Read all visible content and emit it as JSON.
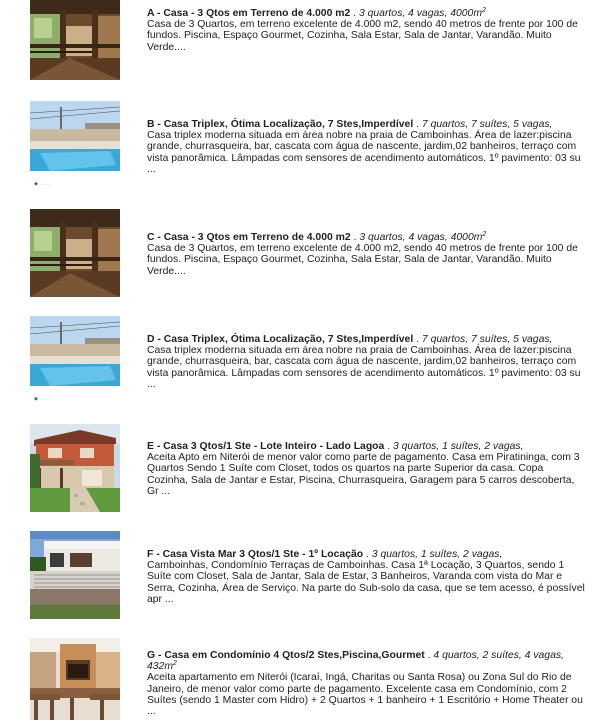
{
  "listings": [
    {
      "title": "A - Casa - 3 Qtos em Terreno de 4.000 m2",
      "meta": "3 quartos, 4 vagas, 4000m",
      "meta_sup": "2",
      "description": "Casa de 3 Quartos, em terreno excelente de 4.000 m2, sendo 40 metros de frente por 100 de fundos. Piscina, Espaço Gourmet, Cozinha, Sala Estar, Sala de Jantar, Varandão. Muito Verde....",
      "image": "house-veranda-photo"
    },
    {
      "title": "B - Casa Triplex, Ótima Localização, 7 Stes,Imperdível",
      "meta": "7 quartos, 7 suítes, 5 vagas,",
      "meta_sup": "",
      "description": "Casa triplex moderna situada em área nobre na praia de Camboinhas. Área de lazer:piscina grande, churrasqueira, bar, cascata com água de nascente, jardim,02 banheiros, terraço com vista panorâmica. Lâmpadas com sensores de acendimento automáticos. 1º pavimento: 03 su ...",
      "image": "pool-photo"
    },
    {
      "title": "C - Casa - 3 Qtos em Terreno de 4.000 m2",
      "meta": "3 quartos, 4 vagas, 4000m",
      "meta_sup": "2",
      "description": "Casa de 3 Quartos, em terreno excelente de 4.000 m2, sendo 40 metros de frente por 100 de fundos. Piscina, Espaço Gourmet, Cozinha, Sala Estar, Sala de Jantar, Varandão. Muito Verde....",
      "image": "house-veranda-photo"
    },
    {
      "title": "D - Casa Triplex, Ótima Localização, 7 Stes,Imperdível",
      "meta": "7 quartos, 7 suítes, 5 vagas,",
      "meta_sup": "",
      "description": "Casa triplex moderna situada em área nobre na praia de Camboinhas. Área de lazer:piscina grande, churrasqueira, bar, cascata com água de nascente, jardim,02 banheiros, terraço com vista panorâmica. Lâmpadas com sensores de acendimento automáticos. 1º pavimento: 03 su ...",
      "image": "pool-photo"
    },
    {
      "title": "E - Casa 3 Qtos/1 Ste - Lote Inteiro - Lado Lagoa",
      "meta": "3 quartos, 1 suítes, 2 vagas,",
      "meta_sup": "",
      "description": "Aceita Apto em Niterói de menor valor como parte de pagamento. Casa em Piratininga, com 3 Quartos Sendo 1 Suíte com Closet, todos os quartos na parte Superior da casa. Copa Cozinha, Sala de Jantar e Estar, Piscina, Churrasqueira, Garagem para 5 carros descoberta, Gr ...",
      "image": "house-lawn-photo"
    },
    {
      "title": "F - Casa Vista Mar 3 Qtos/1 Ste - 1º Locação",
      "meta": "3 quartos, 1 suítes, 2 vagas,",
      "meta_sup": "",
      "description": "Camboinhas, Condomínio Terraças de Camboinhas. Casa 1ª Locação, 3 Quartos, sendo 1 Suíte com Closet, Sala de Jantar, Sala de Estar, 3 Banheiros, Varanda com vista do Mar e Serra, Cozinha, Área de Serviço. Na parte do Sub-solo da casa, que se tem acesso, é possível apr ...",
      "image": "white-house-photo"
    },
    {
      "title": "G - Casa em Condomínio 4 Qtos/2 Stes,Piscina,Gourmet",
      "meta": "4 quartos, 2 suítes, 4 vagas, 432m",
      "meta_sup": "2",
      "description": "Aceita apartamento em Niterói (Icaraí, Ingá, Charitas ou Santa Rosa) ou Zona Sul do Rio de Janeiro, de menor valor como parte de pagamento. Excelente casa em Condomínio, com 2 Suítes (sendo 1 Master com Hidro) + 2 Quartos + 1 banheiro + 1 Escritório + Home Theater ou ...",
      "image": "gourmet-area-photo"
    }
  ]
}
